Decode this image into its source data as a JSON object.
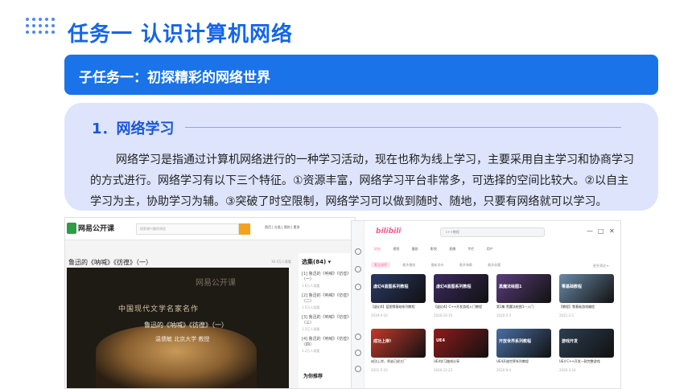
{
  "header": {
    "title": "任务一  认识计算机网络"
  },
  "banner": {
    "text": "子任务一：初探精彩的网络世界"
  },
  "section": {
    "heading": "1．网络学习",
    "paragraph": "网络学习是指通过计算机网络进行的一种学习活动，现在也称为线上学习，主要采用自主学习和协商学习的方式进行。网络学习有以下三个特征。①资源丰富，网络学习平台非常多，可选择的空间比较大。②以自主学习为主，协助学习为辅。③突破了时空限制，网络学习可以做到随时、随地，只要有网络就可以学习。"
  },
  "shot1": {
    "brand": "网易公开课",
    "search_placeholder": "搜索感兴趣的课程",
    "nav": "首页  |  分类  |  我的  |  更多",
    "video_title": "鲁迅的《呐喊》《彷徨》（一）",
    "views": "16.4万人观看",
    "watermark": "网易公开课",
    "video_line1": "中国现代文学名家名作",
    "video_line2": "鲁迅的《呐喊》《彷徨》（一）",
    "video_line3": "温儒敏  北京大学  教授",
    "side_header": "选集(84) ▾",
    "side_items": [
      {
        "title": "[1] 鲁迅的《呐喊》《彷徨》（一）",
        "meta": "1.6万人观看"
      },
      {
        "title": "[2] 鲁迅的《呐喊》《彷徨》（二）",
        "meta": "1.5万人观看"
      },
      {
        "title": "[3] 鲁迅的《呐喊》《彷徨》（三）",
        "meta": "1.3万人观看"
      },
      {
        "title": "[4] 鲁迅的《呐喊》《彷徨》（四）",
        "meta": "1.2万人观看"
      }
    ],
    "recommend": "为你推荐"
  },
  "shot2": {
    "logo": "bilibili",
    "search_text": "c++教程",
    "window_controls": [
      "—",
      "□",
      "✕"
    ],
    "tabs": [
      "综合",
      "视频",
      "番剧",
      "影视",
      "直播",
      "专栏",
      "用户"
    ],
    "filters": [
      "默认排序",
      "最多播放",
      "最新发布",
      "最多弹幕",
      "最多收藏"
    ],
    "sort": "更多筛选 ▾",
    "videos": [
      {
        "caption": "虚幻4蓝图系列教程",
        "title": "【虚幻4】蓝图零基础系列教程",
        "meta": "2019-4-16",
        "color": "#2b3a67"
      },
      {
        "caption": "虚幻4蓝图系列教程",
        "title": "【虚幻4】C++开发游戏入门教程",
        "meta": "2020-10-15",
        "color": "#3b2a5e"
      },
      {
        "caption": "黑魔法绘图1",
        "title": "第1集 黑魔法绘图1—入门",
        "meta": "2020-5-3",
        "color": "#5a3d7a"
      },
      {
        "caption": "零基础教程",
        "title": "【教程】零基础游戏编程",
        "meta": "2021-2-1",
        "color": "#6a8aa8"
      },
      {
        "caption": "成功上岸!",
        "title": "成功上岸，师弟已经大厂",
        "meta": "2021-5-10",
        "color": "#c0392b"
      },
      {
        "caption": "UE4",
        "title": "UE4学习路线分享",
        "meta": "2020-12-25",
        "color": "#8e1b1b"
      },
      {
        "caption": "开放世界系列教程",
        "title": "UE4开放世界系列教程",
        "meta": "2020-9-4",
        "color": "#4a6fa5"
      },
      {
        "caption": "游戏开发",
        "title": "UE4 C++开发一款完整游戏",
        "meta": "2020-3-14",
        "color": "#2c3e50"
      }
    ]
  }
}
